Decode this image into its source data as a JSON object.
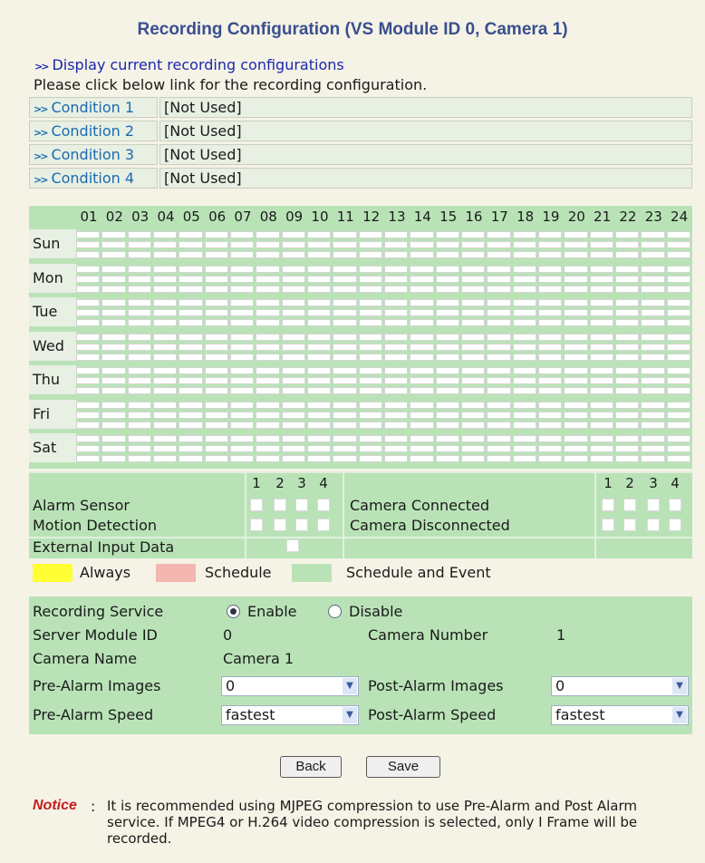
{
  "title": "Recording Configuration (VS Module ID 0, Camera 1)",
  "display_link": "Display current recording configurations",
  "instruction": "Please click below link for the recording configuration.",
  "conditions": [
    {
      "label": "Condition 1",
      "value": "[Not Used]"
    },
    {
      "label": "Condition 2",
      "value": "[Not Used]"
    },
    {
      "label": "Condition 3",
      "value": "[Not Used]"
    },
    {
      "label": "Condition 4",
      "value": "[Not Used]"
    }
  ],
  "hours": [
    "01",
    "02",
    "03",
    "04",
    "05",
    "06",
    "07",
    "08",
    "09",
    "10",
    "11",
    "12",
    "13",
    "14",
    "15",
    "16",
    "17",
    "18",
    "19",
    "20",
    "21",
    "22",
    "23",
    "24"
  ],
  "days": [
    "Sun",
    "Mon",
    "Tue",
    "Wed",
    "Thu",
    "Fri",
    "Sat"
  ],
  "events": {
    "numbers": [
      "1",
      "2",
      "3",
      "4"
    ],
    "alarm_sensor": "Alarm Sensor",
    "motion_detection": "Motion Detection",
    "external_input": "External Input Data",
    "camera_connected": "Camera Connected",
    "camera_disconnected": "Camera Disconnected"
  },
  "legend": {
    "always": "Always",
    "schedule": "Schedule",
    "schedule_event": "Schedule and Event",
    "colors": {
      "always": "#ffff33",
      "schedule": "#f4b6b0",
      "schedule_event": "#b9e3b7"
    }
  },
  "settings": {
    "recording_service_label": "Recording Service",
    "enable": "Enable",
    "disable": "Disable",
    "recording_service_value": "Enable",
    "server_module_label": "Server Module ID",
    "server_module_value": "0",
    "camera_number_label": "Camera Number",
    "camera_number_value": "1",
    "camera_name_label": "Camera Name",
    "camera_name_value": "Camera 1",
    "pre_alarm_images_label": "Pre-Alarm Images",
    "pre_alarm_images_value": "0",
    "post_alarm_images_label": "Post-Alarm Images",
    "post_alarm_images_value": "0",
    "pre_alarm_speed_label": "Pre-Alarm Speed",
    "pre_alarm_speed_value": "fastest",
    "post_alarm_speed_label": "Post-Alarm Speed",
    "post_alarm_speed_value": "fastest"
  },
  "buttons": {
    "back": "Back",
    "save": "Save"
  },
  "notice": {
    "label": "Notice",
    "colon": ":",
    "text": "It is recommended using MJPEG compression to use Pre-Alarm and Post Alarm service. If MPEG4 or H.264 video compression is selected, only I Frame will be recorded."
  }
}
